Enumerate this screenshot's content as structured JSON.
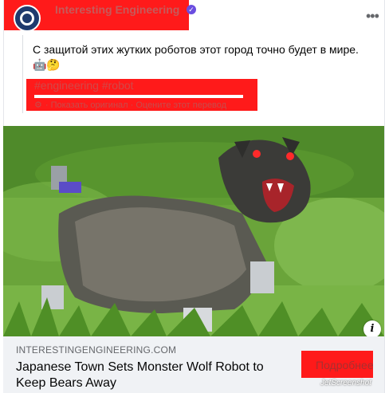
{
  "post": {
    "author": "Interesting Engineering",
    "verified_icon": "check-badge-icon",
    "more_icon": "ellipsis-icon",
    "text": "С защитой этих жутких роботов этот город точно будет в мире.",
    "emoji": "🤖🤔",
    "hashtags": "#engineering #robot",
    "translate_line": "· Показать оригинал · Оцените этот перевод"
  },
  "link_preview": {
    "domain": "INTERESTINGENGINEERING.COM",
    "title": "Japanese Town Sets Monster Wolf Robot to Keep Bears Away",
    "cta": "Подробнее",
    "watermark": "JetScreenshot"
  },
  "colors": {
    "redaction": "#ff1a1a",
    "link_preview_bg": "#f0f2f5"
  }
}
